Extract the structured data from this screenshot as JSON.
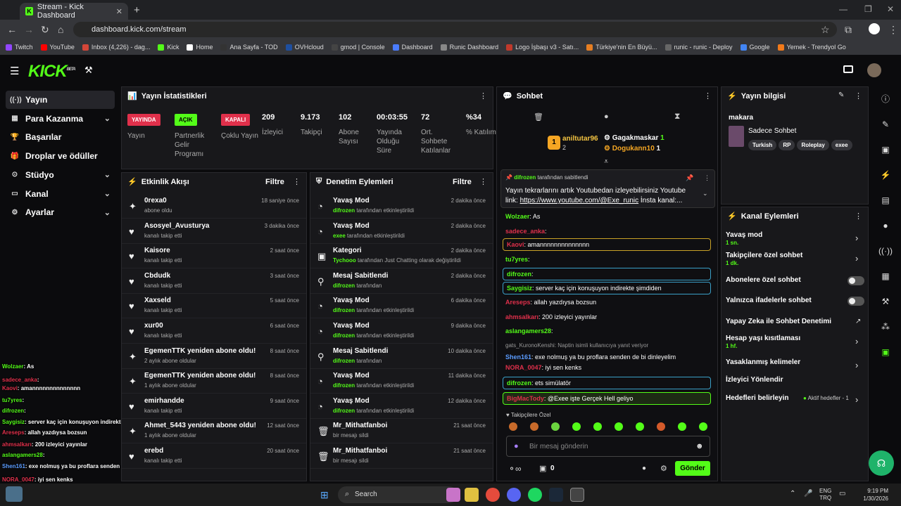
{
  "browser": {
    "tab_title": "Stream - Kick Dashboard",
    "url": "dashboard.kick.com/stream",
    "bookmarks": [
      "Twitch",
      "YouTube",
      "Inbox (4,226) - dag...",
      "Kick",
      "Home",
      "Ana Sayfa - TOD",
      "OVHcloud",
      "gmod | Console",
      "Dashboard",
      "Runic Dashboard",
      "Logo İşbaşı v3 - Satı...",
      "Türkiye'nin En Büyü...",
      "runic - runic - Deploy",
      "Google",
      "Yemek - Trendyol Go"
    ]
  },
  "sidebar": {
    "items": [
      "Yayın",
      "Para Kazanma",
      "Başarılar",
      "Droplar ve ödüller",
      "Stüdyo",
      "Kanal",
      "Ayarlar"
    ]
  },
  "stats": {
    "title": "Yayın İstatistikleri",
    "badges": [
      {
        "text": "YAYINDA",
        "label": "Yayın"
      },
      {
        "text": "AÇIK",
        "label": "Partnerlik Gelir Programı"
      },
      {
        "text": "KAPALI",
        "label": "Çoklu Yayın"
      }
    ],
    "numbers": [
      {
        "value": "209",
        "label": "İzleyici"
      },
      {
        "value": "9.173",
        "label": "Takipçi"
      },
      {
        "value": "102",
        "label": "Abone Sayısı"
      },
      {
        "value": "00:03:55",
        "label": "Yayında Olduğu Süre"
      },
      {
        "value": "72",
        "label": "Ort. Sohbete Katılanlar"
      },
      {
        "value": "%34",
        "label": "% Katılım"
      }
    ]
  },
  "activity": {
    "title": "Etkinlik Akışı",
    "filter": "Filtre",
    "rows": [
      {
        "t": "0rexa0",
        "s": "abone oldu",
        "time": "18 saniye önce",
        "icon": "✦"
      },
      {
        "t": "Asosyel_Avusturya",
        "s": "kanalı takip etti",
        "time": "3 dakika önce",
        "icon": "♥"
      },
      {
        "t": "Kaisore",
        "s": "kanalı takip etti",
        "time": "2 saat önce",
        "icon": "♥"
      },
      {
        "t": "Cbdudk",
        "s": "kanalı takip etti",
        "time": "3 saat önce",
        "icon": "♥"
      },
      {
        "t": "Xaxseld",
        "s": "kanalı takip etti",
        "time": "5 saat önce",
        "icon": "♥"
      },
      {
        "t": "xur00",
        "s": "kanalı takip etti",
        "time": "6 saat önce",
        "icon": "♥"
      },
      {
        "t": "EgemenTTK yeniden abone oldu!",
        "s": "2 aylık abone oldular",
        "time": "8 saat önce",
        "icon": "✦"
      },
      {
        "t": "EgemenTTK yeniden abone oldu!",
        "s": "1 aylık abone oldular",
        "time": "8 saat önce",
        "icon": "✦"
      },
      {
        "t": "emirhandde",
        "s": "kanalı takip etti",
        "time": "9 saat önce",
        "icon": "♥"
      },
      {
        "t": "Ahmet_5443 yeniden abone oldu!",
        "s": "1 aylık abone oldular",
        "time": "12 saat önce",
        "icon": "✦"
      },
      {
        "t": "erebd",
        "s": "kanalı takip etti",
        "time": "20 saat önce",
        "icon": "♥"
      }
    ]
  },
  "moderation": {
    "title": "Denetim Eylemleri",
    "filter": "Filtre",
    "rows": [
      {
        "t": "Yavaş Mod",
        "u": "difrozen",
        "s": "tarafından etkinleştirildi",
        "time": "2 dakika önce",
        "icon": "◔"
      },
      {
        "t": "Yavaş Mod",
        "u": "exee",
        "s": "tarafından etkinleştirildi",
        "time": "2 dakika önce",
        "icon": "◔"
      },
      {
        "t": "Kategori",
        "u": "Tychooo",
        "s": "tarafından Just Chatting olarak değiştirildi",
        "time": "2 dakika önce",
        "icon": "▣"
      },
      {
        "t": "Mesaj Sabitlendi",
        "u": "difrozen",
        "s": "tarafından",
        "time": "2 dakika önce",
        "icon": "⚲"
      },
      {
        "t": "Yavaş Mod",
        "u": "difrozen",
        "s": "tarafından etkinleştirildi",
        "time": "6 dakika önce",
        "icon": "◔"
      },
      {
        "t": "Yavaş Mod",
        "u": "difrozen",
        "s": "tarafından etkinleştirildi",
        "time": "9 dakika önce",
        "icon": "◔"
      },
      {
        "t": "Mesaj Sabitlendi",
        "u": "difrozen",
        "s": "tarafından",
        "time": "10 dakika önce",
        "icon": "⚲"
      },
      {
        "t": "Yavaş Mod",
        "u": "difrozen",
        "s": "tarafından etkinleştirildi",
        "time": "11 dakika önce",
        "icon": "◔"
      },
      {
        "t": "Yavaş Mod",
        "u": "difrozen",
        "s": "tarafından etkinleştirildi",
        "time": "12 dakika önce",
        "icon": "◔"
      },
      {
        "t": "Mr_Mithatfanboi",
        "u": "",
        "s": "bir mesajı sildi",
        "time": "21 saat önce",
        "icon": "🗑"
      },
      {
        "t": "Mr_Mithatfanboi",
        "u": "",
        "s": "bir mesajı sildi",
        "time": "21 saat önce",
        "icon": "🗑"
      }
    ]
  },
  "chat": {
    "title": "Sohbet",
    "top1": "aniltutar96",
    "top1_n": "1",
    "top2": "Gagakmaskar",
    "top2_n": "1",
    "top3": "Dogukann10",
    "top3_n": "1",
    "top_rank_n": "2",
    "pinned_by": "difrozen",
    "pinned_by_suffix": "tarafından sabitlendi",
    "pinned_text": "Yayın tekrarlarını artık Youtubedan izleyebilirsiniz Youtube link: ",
    "pinned_link": "https://www.youtube.com/@Exe_runic",
    "pinned_tail": " İnsta kanal:...",
    "messages": [
      {
        "u": "Wolzaer",
        "c": "#53fc18",
        "m": "As"
      },
      {
        "u": "sadece_anka",
        "c": "#e0304b",
        "m": ""
      },
      {
        "u": "Kaovi",
        "c": "#e0304b",
        "m": "amannnnnnnnnnnnnn"
      },
      {
        "u": "tu7yres",
        "c": "#53fc18",
        "m": ""
      },
      {
        "u": "difrozen",
        "c": "#53fc18",
        "m": ""
      },
      {
        "u": "Saygisiz",
        "c": "#53fc18",
        "m": "server kaç için konuşuyon indirekte şimdiden"
      },
      {
        "u": "Areseps",
        "c": "#e0304b",
        "m": "allah yazdıysa bozsun"
      },
      {
        "u": "ahmsalkarı",
        "c": "#e0304b",
        "m": "200 izleyici yayınlar"
      },
      {
        "u": "aslangamers28",
        "c": "#53fc18",
        "m": ""
      },
      {
        "u": "Shen161",
        "c": "#5b9cff",
        "m": "exe nolmuş ya bu proflara senden de bi dinleyelim"
      },
      {
        "u": "NORA_0047",
        "c": "#e0304b",
        "m": "iyi sen kenks"
      },
      {
        "u": "difrozen",
        "c": "#53fc18",
        "m": "ets simülatör"
      },
      {
        "u": "BigMacTody",
        "c": "#e0304b",
        "m": "@Exee işte Gerçek Hell geliyo"
      }
    ],
    "reply_text": "gats_KuronoKenshi: Naptin isimli kullanıcıya yanıt veriyor",
    "emote_label": "Takipçilere Özel",
    "placeholder": "Bir mesaj gönderin",
    "send": "Gönder",
    "viewers": "0"
  },
  "info": {
    "title": "Yayın bilgisi",
    "name": "makara",
    "category": "Sadece Sohbet",
    "tags": [
      "Turkish",
      "RP",
      "Roleplay",
      "exee"
    ]
  },
  "actions": {
    "title": "Kanal Eylemleri",
    "items": [
      {
        "t": "Yavaş mod",
        "s": "1 sn.",
        "kind": "chev"
      },
      {
        "t": "Takipçilere özel sohbet",
        "s": "1 dk.",
        "kind": "chev"
      },
      {
        "t": "Abonelere özel sohbet",
        "s": "",
        "kind": "toggle"
      },
      {
        "t": "Yalnızca ifadelerle sohbet",
        "s": "",
        "kind": "toggle"
      },
      {
        "t": "Yapay Zeka ile Sohbet Denetimi",
        "s": "",
        "kind": "ext"
      },
      {
        "t": "Hesap yaşı kısıtlaması",
        "s": "1 hf.",
        "kind": "chev"
      },
      {
        "t": "Yasaklanmış kelimeler",
        "s": "",
        "kind": "chev"
      },
      {
        "t": "İzleyici Yönlendir",
        "s": "",
        "kind": "none"
      },
      {
        "t": "Hedefleri belirleyin",
        "s": "",
        "kind": "goal"
      }
    ],
    "goal_text": "Aktif hedefler - 1"
  },
  "taskbar": {
    "search": "Search",
    "lang1": "ENG",
    "lang2": "TRQ",
    "time": "9:19 PM",
    "date": "1/30/2026"
  }
}
